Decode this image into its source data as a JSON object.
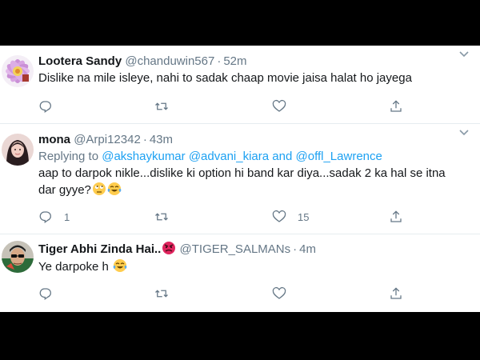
{
  "colors": {
    "accent": "#1da1f2",
    "text": "#14171a",
    "muted": "#657786",
    "divider": "#e6ecf0",
    "background_outer": "#000000",
    "background_panel": "#ffffff"
  },
  "tweets": [
    {
      "name": "Lootera Sandy",
      "handle": "@chanduwin567",
      "time": "52m",
      "text": "Dislike na mile isleye, nahi to sadak chaap movie jaisa halat ho jayega",
      "reply_count": "",
      "like_count": "",
      "icons": [
        "reply-icon",
        "retweet-icon",
        "like-icon",
        "share-icon"
      ]
    },
    {
      "name": "mona",
      "handle": "@Arpi12342",
      "time": "43m",
      "replying_prefix": "Replying to",
      "replying_mentions": [
        "@akshaykumar",
        "@advani_kiara",
        "@offl_Lawrence"
      ],
      "replying_conjunction": "and",
      "text_line1": "aap to darpok nikle...dislike ki option hi band kar diya...sadak 2 ka hal se itna",
      "text_line2": "dar gyye?",
      "reply_count": "1",
      "like_count": "15",
      "icons": [
        "reply-icon",
        "retweet-icon",
        "like-icon",
        "share-icon"
      ]
    },
    {
      "name": "Tiger Abhi Zinda Hai..",
      "handle": "@TIGER_SALMANs",
      "time": "4m",
      "text": "Ye darpoke h",
      "reply_count": "",
      "like_count": "",
      "icons": [
        "reply-icon",
        "retweet-icon",
        "like-icon",
        "share-icon"
      ]
    }
  ],
  "separator": "·"
}
